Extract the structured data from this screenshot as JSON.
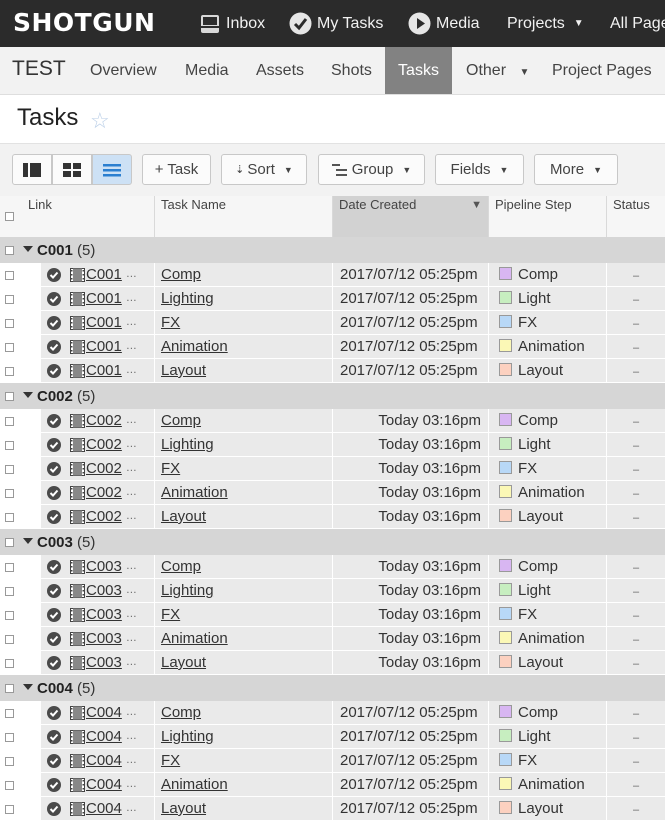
{
  "app": {
    "logo": "SHOTGUN",
    "nav": [
      {
        "label": "Inbox",
        "icon": "inbox-icon"
      },
      {
        "label": "My Tasks",
        "icon": "check-circle-icon"
      },
      {
        "label": "Media",
        "icon": "play-circle-icon"
      },
      {
        "label": "Projects",
        "icon": "chevron-down-icon"
      },
      {
        "label": "All Pages",
        "icon": ""
      }
    ]
  },
  "project": {
    "name": "TEST",
    "tabs": [
      {
        "label": "Overview"
      },
      {
        "label": "Media"
      },
      {
        "label": "Assets"
      },
      {
        "label": "Shots"
      },
      {
        "label": "Tasks",
        "active": true
      },
      {
        "label": "Other"
      },
      {
        "label": "Project Pages"
      }
    ]
  },
  "page": {
    "title": "Tasks",
    "favorite_icon": "star-outline-icon"
  },
  "toolbar": {
    "views": [
      "sidebar-view-icon",
      "thumbnail-view-icon",
      "list-view-icon"
    ],
    "active_view": "list-view-icon",
    "add_task": "+ Task",
    "sort": "Sort",
    "group": "Group",
    "fields": "Fields",
    "more": "More"
  },
  "columns": {
    "link": "Link",
    "task_name": "Task Name",
    "date_created": "Date Created",
    "pipeline_step": "Pipeline Step",
    "status": "Status"
  },
  "step_colors": {
    "Comp": "#d8b6f2",
    "Light": "#c7eec0",
    "FX": "#b8d8f7",
    "Animation": "#fbf8b6",
    "Layout": "#fcd1c0"
  },
  "groups": [
    {
      "name": "C001",
      "count": "(5)",
      "rows": [
        {
          "link": "C001",
          "task": "Comp",
          "date": "2017/07/12 05:25pm",
          "step": "Comp",
          "status": "–"
        },
        {
          "link": "C001",
          "task": "Lighting",
          "date": "2017/07/12 05:25pm",
          "step": "Light",
          "status": "–"
        },
        {
          "link": "C001",
          "task": "FX",
          "date": "2017/07/12 05:25pm",
          "step": "FX",
          "status": "–"
        },
        {
          "link": "C001",
          "task": "Animation",
          "date": "2017/07/12 05:25pm",
          "step": "Animation",
          "status": "–"
        },
        {
          "link": "C001",
          "task": "Layout",
          "date": "2017/07/12 05:25pm",
          "step": "Layout",
          "status": "–"
        }
      ]
    },
    {
      "name": "C002",
      "count": "(5)",
      "rows": [
        {
          "link": "C002",
          "task": "Comp",
          "date": "Today 03:16pm",
          "step": "Comp",
          "status": "–"
        },
        {
          "link": "C002",
          "task": "Lighting",
          "date": "Today 03:16pm",
          "step": "Light",
          "status": "–"
        },
        {
          "link": "C002",
          "task": "FX",
          "date": "Today 03:16pm",
          "step": "FX",
          "status": "–"
        },
        {
          "link": "C002",
          "task": "Animation",
          "date": "Today 03:16pm",
          "step": "Animation",
          "status": "–"
        },
        {
          "link": "C002",
          "task": "Layout",
          "date": "Today 03:16pm",
          "step": "Layout",
          "status": "–"
        }
      ]
    },
    {
      "name": "C003",
      "count": "(5)",
      "rows": [
        {
          "link": "C003",
          "task": "Comp",
          "date": "Today 03:16pm",
          "step": "Comp",
          "status": "–"
        },
        {
          "link": "C003",
          "task": "Lighting",
          "date": "Today 03:16pm",
          "step": "Light",
          "status": "–"
        },
        {
          "link": "C003",
          "task": "FX",
          "date": "Today 03:16pm",
          "step": "FX",
          "status": "–"
        },
        {
          "link": "C003",
          "task": "Animation",
          "date": "Today 03:16pm",
          "step": "Animation",
          "status": "–"
        },
        {
          "link": "C003",
          "task": "Layout",
          "date": "Today 03:16pm",
          "step": "Layout",
          "status": "–"
        }
      ]
    },
    {
      "name": "C004",
      "count": "(5)",
      "rows": [
        {
          "link": "C004",
          "task": "Comp",
          "date": "2017/07/12 05:25pm",
          "step": "Comp",
          "status": "–"
        },
        {
          "link": "C004",
          "task": "Lighting",
          "date": "2017/07/12 05:25pm",
          "step": "Light",
          "status": "–"
        },
        {
          "link": "C004",
          "task": "FX",
          "date": "2017/07/12 05:25pm",
          "step": "FX",
          "status": "–"
        },
        {
          "link": "C004",
          "task": "Animation",
          "date": "2017/07/12 05:25pm",
          "step": "Animation",
          "status": "–"
        },
        {
          "link": "C004",
          "task": "Layout",
          "date": "2017/07/12 05:25pm",
          "step": "Layout",
          "status": "–"
        }
      ]
    }
  ]
}
